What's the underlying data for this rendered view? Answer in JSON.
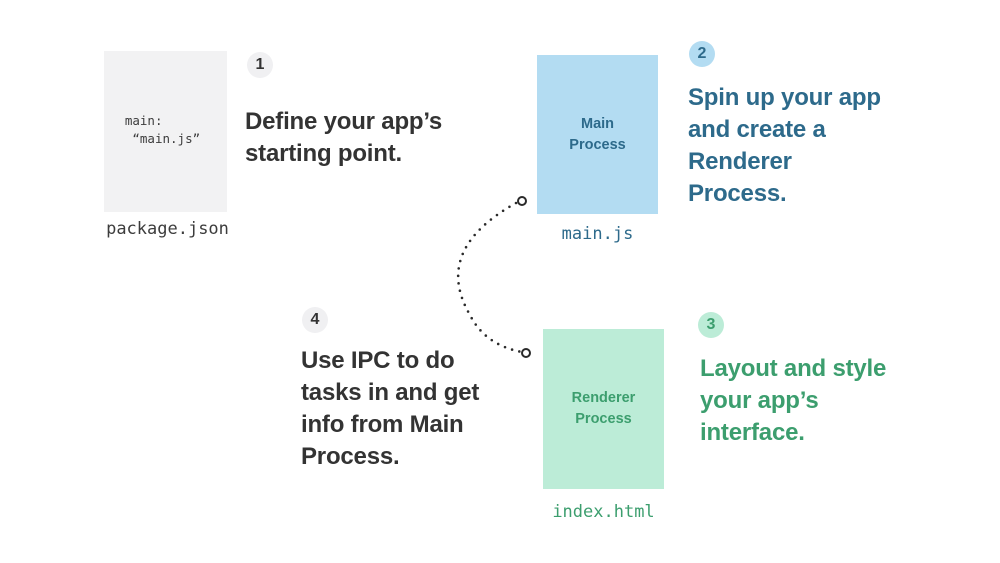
{
  "steps": [
    {
      "number": "1",
      "text": "Define your app’s\nstarting point.",
      "file_box": {
        "code": "main:\n “main.js”"
      },
      "file_name": "package.json"
    },
    {
      "number": "2",
      "text": "Spin up your app\nand create a\nRenderer\nProcess.",
      "file_box": {
        "label": "Main\nProcess"
      },
      "file_name": "main.js"
    },
    {
      "number": "3",
      "text": "Layout and style\nyour app’s\ninterface.",
      "file_box": {
        "label": "Renderer\nProcess"
      },
      "file_name": "index.html"
    },
    {
      "number": "4",
      "text": "Use IPC to do\ntasks in and get\ninfo from Main\nProcess."
    }
  ],
  "colors": {
    "neutral_text": "#333333",
    "main_accent": "#2d6a8b",
    "main_fill": "#b3dcf2",
    "renderer_accent": "#3c9e6e",
    "renderer_fill": "#bcecd7",
    "package_fill": "#f2f2f3"
  },
  "connector": {
    "style": "dotted-arc",
    "from": "main-process",
    "to": "renderer-process",
    "end_markers": "open-circle"
  }
}
